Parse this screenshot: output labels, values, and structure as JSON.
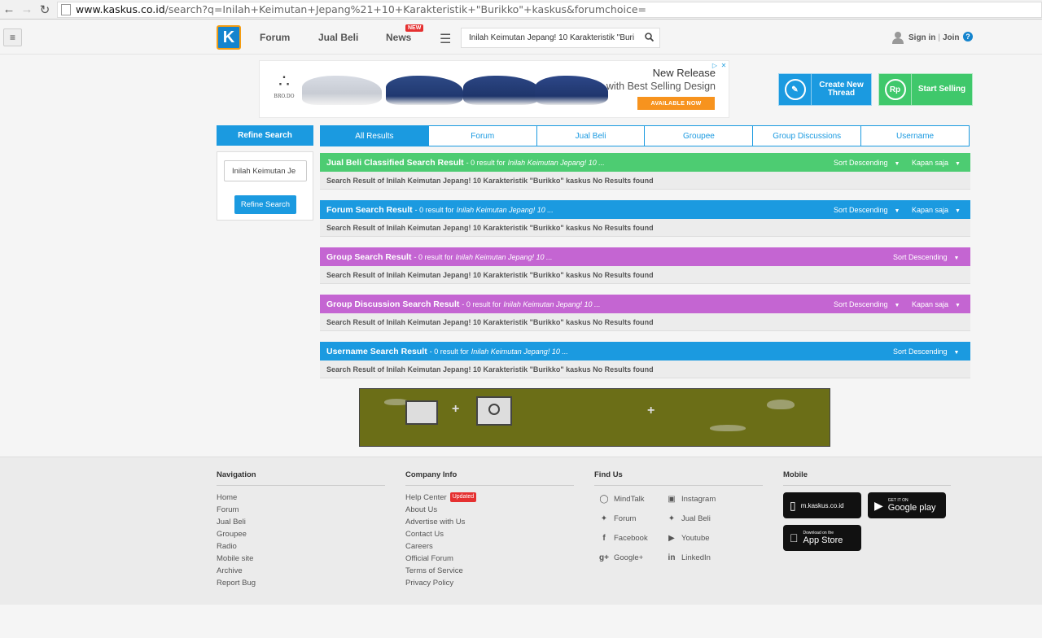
{
  "browser": {
    "url_host": "www.kaskus.co.id",
    "url_rest": "/search?q=Inilah+Keimutan+Jepang%21+10+Karakteristik+\"Burikko\"+kaskus&forumchoice="
  },
  "header": {
    "logo_text": "K",
    "nav": {
      "forum": "Forum",
      "jualbeli": "Jual Beli",
      "news": "News",
      "new_badge": "NEW"
    },
    "search_value": "Inilah Keimutan Jepang! 10 Karakteristik \"Buri",
    "signin": "Sign in",
    "separator": "|",
    "join": "Join",
    "help": "?"
  },
  "banner": {
    "brand": "BRO.DO",
    "headline": "New Release",
    "subheadline": "with Best Selling Design",
    "cta": "AVAILABLE NOW"
  },
  "actions": {
    "create_thread": "Create New Thread",
    "start_selling": "Start Selling",
    "start_selling_icon": "Rp"
  },
  "refine": {
    "header": "Refine Search",
    "input_value": "Inilah Keimutan Je",
    "button": "Refine Search"
  },
  "tabs": [
    "All Results",
    "Forum",
    "Jual Beli",
    "Groupee",
    "Group Discussions",
    "Username"
  ],
  "sections": [
    {
      "title": "Jual Beli Classified Search Result",
      "meta": "- 0 result for",
      "query": "Inilah Keimutan Jepang! 10 ...",
      "sort": "Sort Descending",
      "filter": "Kapan saja",
      "body": "Search Result of Inilah Keimutan Jepang! 10 Karakteristik \"Burikko\" kaskus No Results found"
    },
    {
      "title": "Forum Search Result",
      "meta": "- 0 result for",
      "query": "Inilah Keimutan Jepang! 10 ...",
      "sort": "Sort Descending",
      "filter": "Kapan saja",
      "body": "Search Result of Inilah Keimutan Jepang! 10 Karakteristik \"Burikko\" kaskus No Results found"
    },
    {
      "title": "Group Search Result",
      "meta": "- 0 result for",
      "query": "Inilah Keimutan Jepang! 10 ...",
      "sort": "Sort Descending",
      "body": "Search Result of Inilah Keimutan Jepang! 10 Karakteristik \"Burikko\" kaskus No Results found"
    },
    {
      "title": "Group Discussion Search Result",
      "meta": "- 0 result for",
      "query": "Inilah Keimutan Jepang! 10 ...",
      "sort": "Sort Descending",
      "filter": "Kapan saja",
      "body": "Search Result of Inilah Keimutan Jepang! 10 Karakteristik \"Burikko\" kaskus No Results found"
    },
    {
      "title": "Username Search Result",
      "meta": "- 0 result for",
      "query": "Inilah Keimutan Jepang! 10 ...",
      "sort": "Sort Descending",
      "body": "Search Result of Inilah Keimutan Jepang! 10 Karakteristik \"Burikko\" kaskus No Results found"
    }
  ],
  "footer": {
    "navigation": {
      "heading": "Navigation",
      "items": [
        "Home",
        "Forum",
        "Jual Beli",
        "Groupee",
        "Radio",
        "Mobile site",
        "Archive",
        "Report Bug"
      ]
    },
    "company": {
      "heading": "Company Info",
      "items": [
        "Help Center",
        "About Us",
        "Advertise with Us",
        "Contact Us",
        "Careers",
        "Official Forum",
        "Terms of Service",
        "Privacy Policy"
      ],
      "updated_badge": "Updated"
    },
    "find": {
      "heading": "Find Us",
      "items": [
        "MindTalk",
        "Instagram",
        "Forum",
        "Jual Beli",
        "Facebook",
        "Youtube",
        "Google+",
        "LinkedIn"
      ]
    },
    "mobile": {
      "heading": "Mobile",
      "mobile_site": "m.kaskus.co.id",
      "google_small": "GET IT ON",
      "google_big": "Google play",
      "apple_small": "Download on the",
      "apple_big": "App Store"
    }
  },
  "colors": {
    "primary": "#1b9ae0",
    "green": "#4dcc72",
    "purple": "#c465d2",
    "orange": "#f7931e"
  }
}
